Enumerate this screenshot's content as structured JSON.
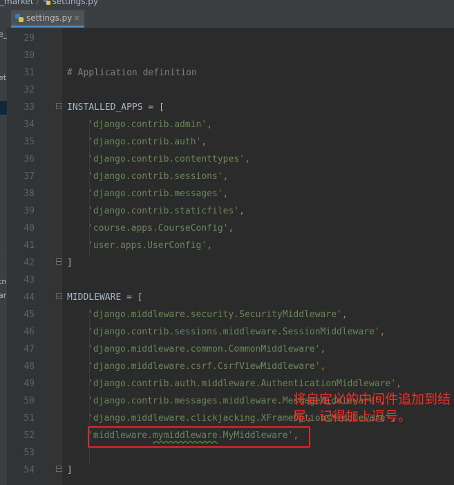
{
  "breadcrumb": {
    "project": "_market",
    "file": "settings.py"
  },
  "tab": {
    "filename": "settings.py",
    "close_glyph": "×"
  },
  "sidebar": {
    "items": [
      "e_",
      "et",
      "l",
      "tn",
      "ar"
    ]
  },
  "line_numbers": [
    "29",
    "30",
    "31",
    "32",
    "33",
    "34",
    "35",
    "36",
    "37",
    "38",
    "39",
    "40",
    "41",
    "42",
    "43",
    "44",
    "45",
    "46",
    "47",
    "48",
    "49",
    "50",
    "51",
    "52",
    "53",
    "54"
  ],
  "code": {
    "comment": "# Application definition",
    "installed_apps_name": "INSTALLED_APPS",
    "eq_bracket": " = [",
    "close_bracket": "]",
    "middleware_name": "MIDDLEWARE",
    "comma": ",",
    "installed_apps": [
      "'django.contrib.admin'",
      "'django.contrib.auth'",
      "'django.contrib.contenttypes'",
      "'django.contrib.sessions'",
      "'django.contrib.messages'",
      "'django.contrib.staticfiles'",
      "'course.apps.CourseConfig'",
      "'user.apps.UserConfig'"
    ],
    "middleware": [
      "'django.middleware.security.SecurityMiddleware'",
      "'django.contrib.sessions.middleware.SessionMiddleware'",
      "'django.middleware.common.CommonMiddleware'",
      "'django.middleware.csrf.CsrfViewMiddleware'",
      "'django.contrib.auth.middleware.AuthenticationMiddleware'",
      "'django.contrib.messages.middleware.MessageMiddleware'",
      "'django.middleware.clickjacking.XFrameOptionsMiddleware'"
    ],
    "custom_middleware": {
      "prefix": "'middleware.",
      "underlined": "mymiddleware",
      "suffix": ".MyMiddleware'"
    }
  },
  "annotation": {
    "text": "将自定义的中间件追加到结尾，记得加上逗号。",
    "color": "#ff2a22"
  },
  "colors": {
    "editor_bg": "#2b2b2b",
    "gutter_bg": "#313335",
    "string": "#6a8759",
    "keyword": "#cc7832",
    "comment": "#808080",
    "highlight_box": "#e3242b"
  }
}
